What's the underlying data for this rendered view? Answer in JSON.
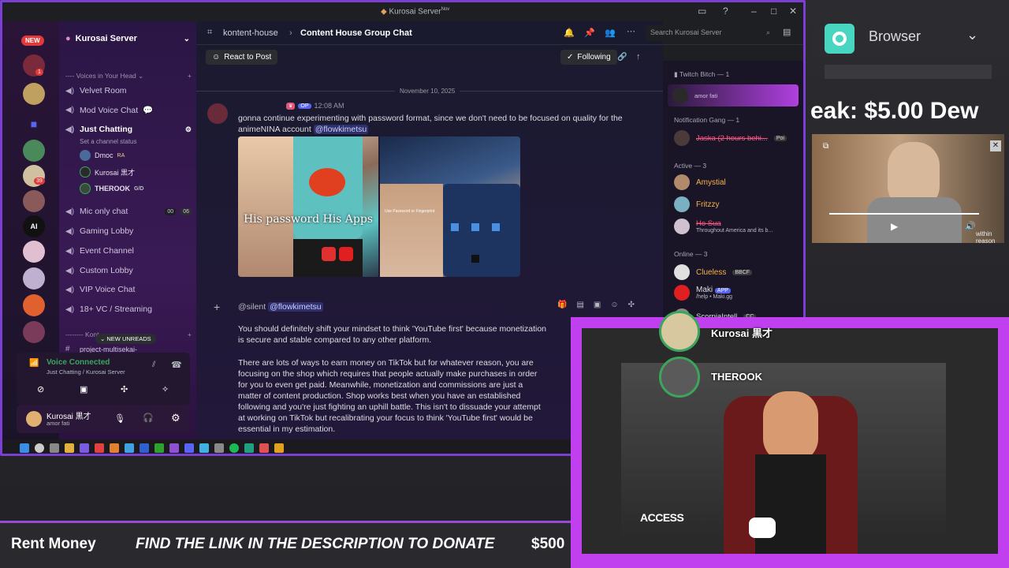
{
  "window": {
    "title": "Kurosai Server",
    "title_sup": "Nov"
  },
  "servers": {
    "new_badge": "NEW",
    "items": [
      "",
      "",
      "",
      "",
      "",
      "",
      "AI",
      "",
      "",
      "",
      ""
    ],
    "badges": [
      "1",
      "39"
    ]
  },
  "server_header": {
    "name": "Kurosai Server"
  },
  "channels": {
    "category_voices": "---- Voices in Your Head",
    "items": [
      {
        "label": "Velvet Room"
      },
      {
        "label": "Mod Voice Chat"
      },
      {
        "label": "Just Chatting"
      },
      {
        "label": "Mic only chat"
      },
      {
        "label": "Gaming Lobby"
      },
      {
        "label": "Event Channel"
      },
      {
        "label": "Custom Lobby"
      },
      {
        "label": "VIP Voice Chat"
      },
      {
        "label": "18+ VC / Streaming"
      }
    ],
    "just_chatting_status": "Set a channel status",
    "voice_users": [
      {
        "name": "Dmoc",
        "tag": "RA"
      },
      {
        "name": "Kurosai 黒才",
        "tag": ""
      },
      {
        "name": "THEROOK",
        "tag": "G/D"
      }
    ],
    "mic_only_counts": [
      "00",
      "06"
    ],
    "category_kontent": "-------- Kont...",
    "new_unreads": "NEW UNREADS",
    "project_channel": "project-multisekai-"
  },
  "voice_panel": {
    "status": "Voice Connected",
    "location": "Just Chatting / Kurosai Server"
  },
  "user_panel": {
    "name": "Kurosai 黒才",
    "status": "amor fati"
  },
  "chat_header": {
    "channel": "kontent-house",
    "thread": "Content House Group Chat",
    "search_placeholder": "Search Kurosai Server"
  },
  "post_bar": {
    "react": "React to Post",
    "following": "Following"
  },
  "date_divider": "November 10, 2025",
  "message1": {
    "time": "12:08 AM",
    "tag": "OP",
    "text": "gonna continue experimenting with password format, since we don't need to be focused on quality for the animeNINA account",
    "mention": "@flowkimetsu",
    "image1_caption": "His password His Apps",
    "image2_caption": "Use Password or Fingerprint"
  },
  "message2": {
    "prefix": "@silent",
    "mention": "@flowkimetsu",
    "para1": "You should definitely shift your mindset to think 'YouTube first' because monetization is secure and stable compared to any other platform.",
    "para2": "There are lots of ways to earn money on TikTok but for whatever reason, you are focusing on the shop which requires that people actually make purchases in order for you to even get paid. Meanwhile, monetization and commissions are just a matter of content production. Shop works best when you have an established following and you're just fighting an uphill battle. This isn't to dissuade your attempt at working on TikTok but recalibrating your focus to think 'YouTube first' would be essential in my estimation."
  },
  "members": {
    "groups": [
      {
        "title": "Twitch Bitch — 1",
        "members": [
          {
            "name": "",
            "sub": "amor fati",
            "color": "#c8a8ff"
          }
        ]
      },
      {
        "title": "Notification Gang — 1",
        "members": [
          {
            "name": "Jaska (2 hours behi...",
            "sub": "Poi",
            "color": "#ff5a87"
          }
        ]
      },
      {
        "title": "Active — 3",
        "members": [
          {
            "name": "Amystial",
            "sub": "",
            "color": "#f2b14c"
          },
          {
            "name": "Fritzzy",
            "sub": "",
            "color": "#f2b14c"
          },
          {
            "name": "Ho Sua",
            "sub": "Throughout America and its b...",
            "color": "#ff5a87"
          }
        ]
      },
      {
        "title": "Online — 3",
        "members": [
          {
            "name": "Clueless",
            "sub": "BBCF",
            "color": "#f2b14c"
          },
          {
            "name": "Maki",
            "sub": "/help • Maki.gg",
            "color": "#dbdee1"
          },
          {
            "name": "ScorpiaIntell",
            "sub": "CC",
            "color": "#dbdee1"
          }
        ]
      }
    ],
    "maki_badge": "APP"
  },
  "overlay": {
    "browser_label": "Browser",
    "tip_text": "eak: $5.00   Dew",
    "video_speakers": [
      {
        "name": "Kurosai 黒才"
      },
      {
        "name": "THEROOK"
      }
    ],
    "access_logo": "ACCESS",
    "cam_watermark": "within reason"
  },
  "ticker": {
    "left": "Rent Money",
    "main": "FIND THE LINK IN THE DESCRIPTION TO DONATE",
    "amount": "$500"
  }
}
